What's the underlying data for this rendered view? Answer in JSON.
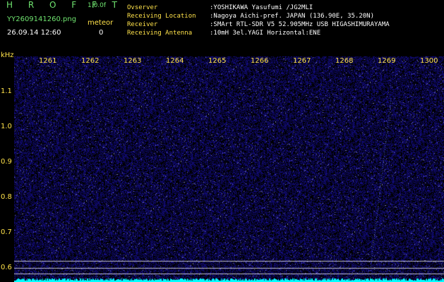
{
  "header": {
    "brand": "H R O F F T",
    "version": "1.0.0f",
    "filename": "YY2609141260.png",
    "datetime": "26.09.14 12:60",
    "meteor_label": "meteor",
    "meteor_count": "0",
    "info": [
      {
        "key": "Ovserver",
        "value": ":YOSHIKAWA Yasufumi /JG2MLI"
      },
      {
        "key": "Receiving Location",
        "value": ":Nagoya Aichi-pref. JAPAN (136.90E, 35.20N)"
      },
      {
        "key": "Receiver",
        "value": ":SMArt RTL-SDR V5 52.905MHz USB HIGASHIMURAYAMA"
      },
      {
        "key": "Receiving Antenna",
        "value": ":10mH 3el.YAGI Horizontal:ENE"
      }
    ]
  },
  "axes": {
    "y_unit": "kHz",
    "y_ticks": [
      "1.1",
      "1.0",
      "0.9",
      "0.8",
      "0.7",
      "0.6"
    ],
    "x_ticks": [
      "1261",
      "1262",
      "1263",
      "1264",
      "1265",
      "1266",
      "1267",
      "1268",
      "1269",
      "1300"
    ]
  },
  "colors": {
    "background": "#000000",
    "noise": "#1a1a8c",
    "axis_text": "#ffe24a",
    "header_green": "#6fe36f",
    "header_label_yellow": "#ffe24a",
    "signal_cyan": "#00ffff",
    "line": "#c0c0d0"
  }
}
